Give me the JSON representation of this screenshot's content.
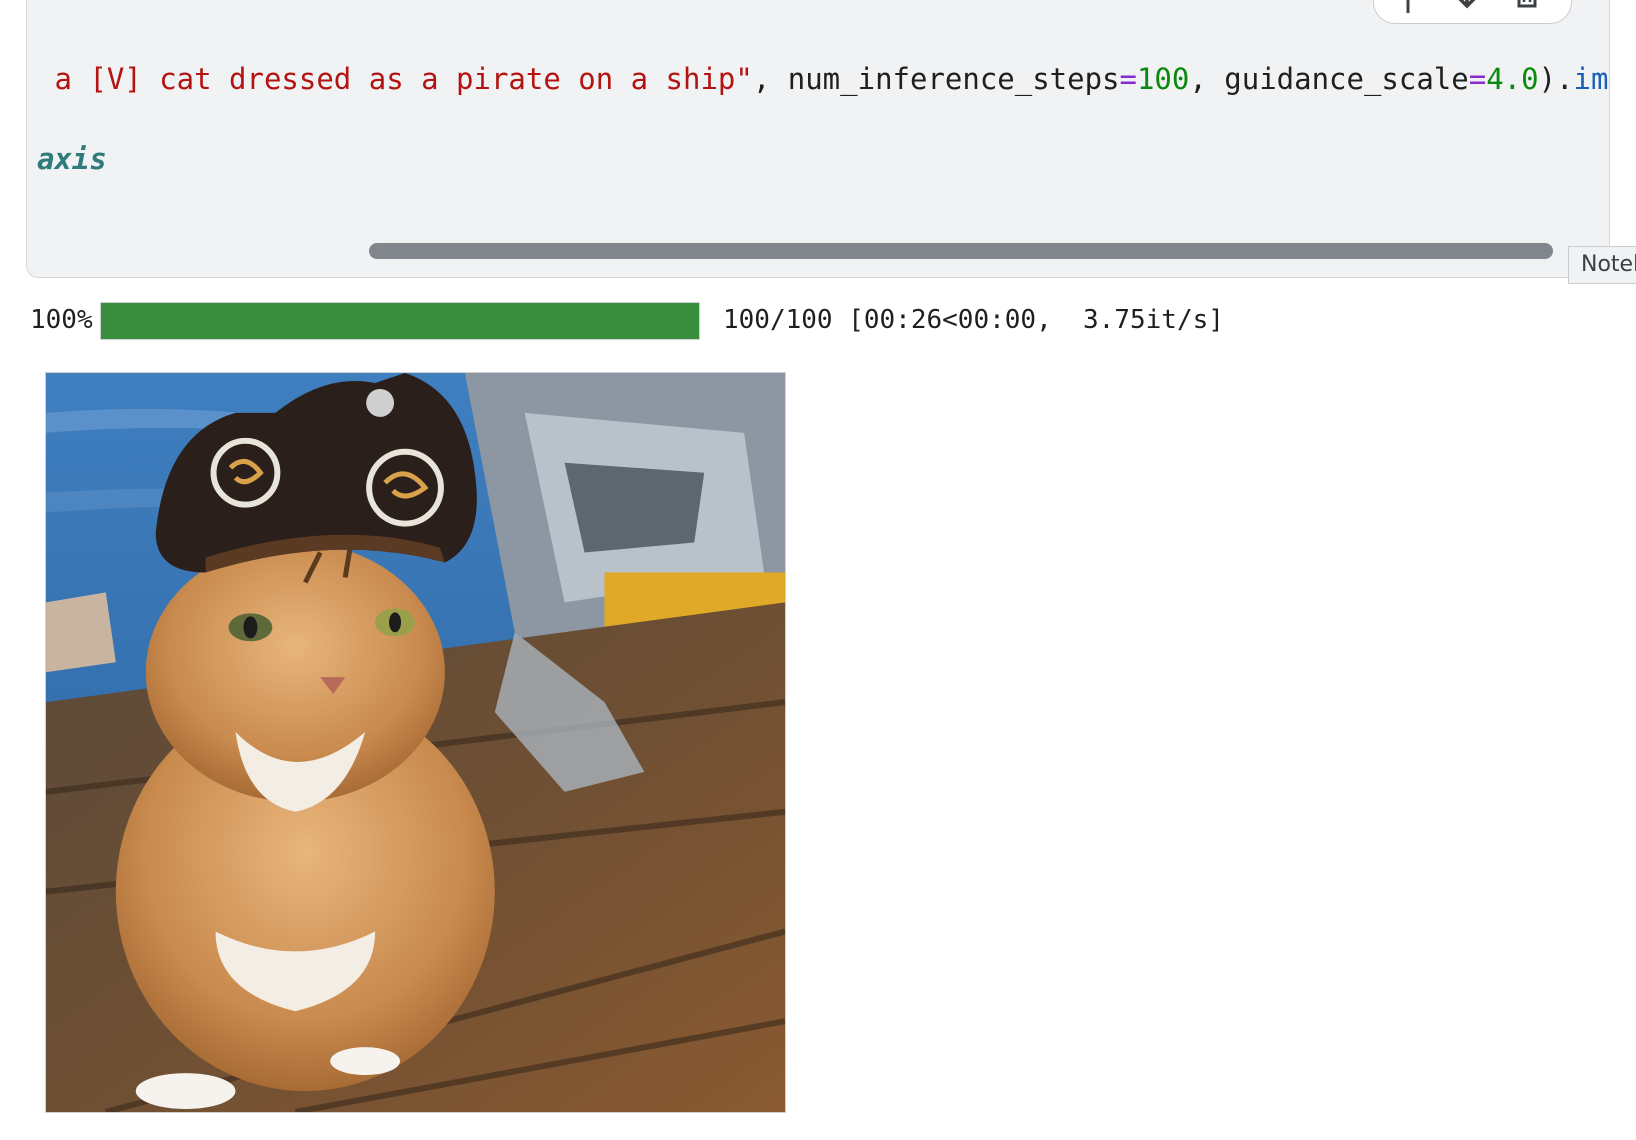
{
  "code_cell": {
    "line1": {
      "string_literal": "\u0010 a [V] cat dressed as a pirate on a ship\"",
      "comma1": ", ",
      "param1_name": "num_inference_steps",
      "eq1": "=",
      "param1_value": "100",
      "comma2": ", ",
      "param2_name": "guidance_scale",
      "eq2": "=",
      "param2_value": "4.0",
      "close": ").",
      "attr": "images"
    },
    "line2": {
      "keyword": "axis"
    },
    "toolbar_icons": [
      "arrow-up-icon",
      "arrow-down-icon",
      "delete-icon"
    ]
  },
  "side_tab": {
    "label": "Notebook"
  },
  "progress": {
    "percent_label": "100%",
    "fraction": 1.0,
    "stats": "100/100 [00:26<00:00,  3.75it/s]",
    "color": "#388e3c"
  },
  "output": {
    "image_subject": "orange tabby cat wearing a pirate hat on a wooden ship deck"
  }
}
